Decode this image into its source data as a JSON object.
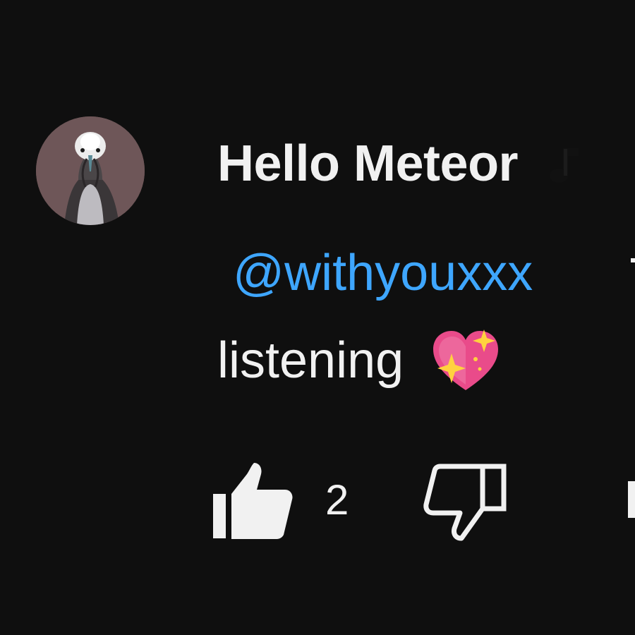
{
  "comment": {
    "author": "Hello Meteor",
    "author_badge_icon": "music-note-icon",
    "mention": "@withyouxxx",
    "text_line2": "listening",
    "emoji": "sparkling-heart-icon",
    "like_count": "2"
  },
  "colors": {
    "background": "#0f0f0f",
    "text": "#f1f1f1",
    "mention": "#3ea6ff",
    "avatar_bg": "#6e5658"
  }
}
